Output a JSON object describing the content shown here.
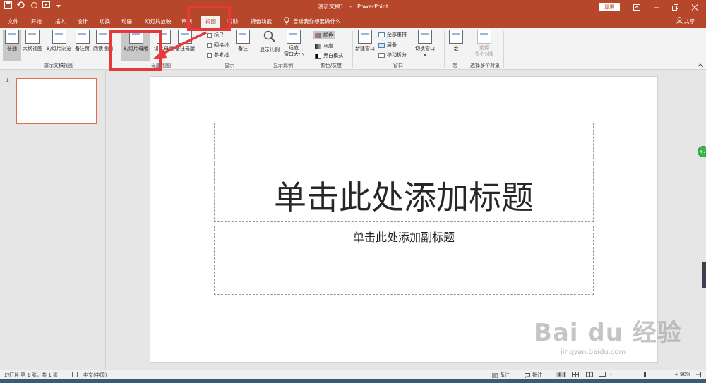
{
  "window": {
    "doc_title": "演示文稿1",
    "separator": "-",
    "app_name": "PowerPoint",
    "login_label": "登录",
    "share_label": "共享"
  },
  "tabs": [
    {
      "label": "文件"
    },
    {
      "label": "开始"
    },
    {
      "label": "插入"
    },
    {
      "label": "设计"
    },
    {
      "label": "切换"
    },
    {
      "label": "动画"
    },
    {
      "label": "幻灯片放映"
    },
    {
      "label": "审阅"
    },
    {
      "label": "视图",
      "active": true
    },
    {
      "label": "帮助"
    },
    {
      "label": "特色功能"
    }
  ],
  "tell_me": "告诉我你想要做什么",
  "ribbon": {
    "groups": {
      "presentation_views": "演示文稿视图",
      "master_views": "母版视图",
      "show": "显示",
      "zoom": "显示比例",
      "color_gray": "颜色/灰度",
      "window": "窗口",
      "macros": "宏",
      "select_multiple": "选择多个对象"
    },
    "buttons": {
      "normal": "普通",
      "outline": "大纲视图",
      "slide_sorter": "幻灯片浏览",
      "notes_page": "备注页",
      "reading_view": "阅读视图",
      "slide_master": "幻灯片母版",
      "handout_master": "讲义母版",
      "notes_master": "备注母版",
      "ruler": "标尺",
      "gridlines": "网格线",
      "guides": "参考线",
      "notes": "备注",
      "zoom": "显示比例",
      "fit_window_1": "适应",
      "fit_window_2": "窗口大小",
      "color": "颜色",
      "grayscale": "灰度",
      "black_white": "黑白模式",
      "new_window": "新建窗口",
      "arrange_all": "全部重排",
      "cascade": "层叠",
      "move_split": "移动拆分",
      "switch_windows": "切换窗口",
      "macros": "宏",
      "select_multiple_1": "选择",
      "select_multiple_2": "多个对象"
    }
  },
  "thumbnail": {
    "number": "1"
  },
  "slide": {
    "title_placeholder": "单击此处添加标题",
    "subtitle_placeholder": "单击此处添加副标题"
  },
  "side_badge": "67",
  "status": {
    "slide_info": "幻灯片 第 1 张，共 1 张",
    "language": "中文(中国)",
    "notes": "备注",
    "comments": "批注",
    "zoom_level": "90%",
    "zoom_minus": "-",
    "zoom_plus": "+"
  },
  "watermark": {
    "brand": "Bai du 经验",
    "url": "jingyan.baidu.com"
  },
  "colors": {
    "accent": "#b7472a",
    "highlight": "#e63a3a"
  }
}
